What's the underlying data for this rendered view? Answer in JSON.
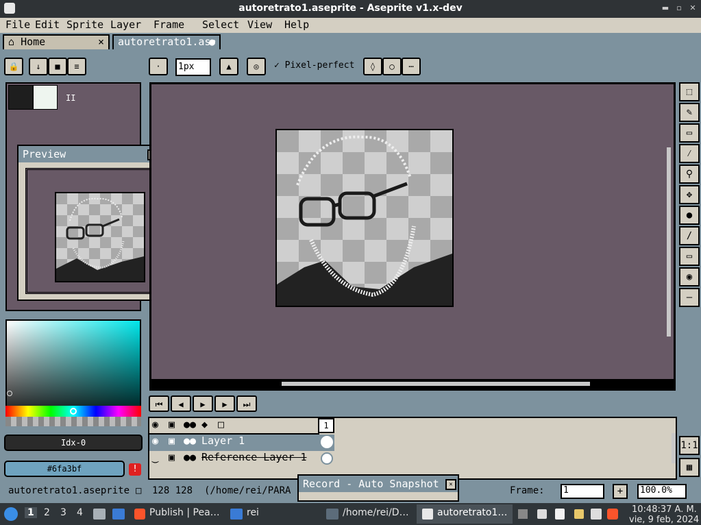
{
  "window": {
    "title": "autoretrato1.aseprite - Aseprite v1.x-dev"
  },
  "menu": [
    "File",
    "Edit",
    "Sprite",
    "Layer",
    "Frame",
    "Select",
    "View",
    "Help"
  ],
  "tabs": {
    "home": "Home",
    "doc": "autoretrato1.as•",
    "home_close": "×",
    "doc_dot": "●"
  },
  "context_bar": {
    "brush_size": "1px",
    "pixel_perfect": "Pixel-perfect",
    "more": "⋯"
  },
  "palette": {
    "count_label": "II"
  },
  "preview": {
    "title": "Preview"
  },
  "color": {
    "index": "Idx-0",
    "hex": "#6fa3bf",
    "warning": "!"
  },
  "timeline": {
    "frame_number": "1",
    "layers": [
      {
        "name": "Layer 1"
      },
      {
        "name": "Reference Layer 1"
      }
    ]
  },
  "status": {
    "filename": "autoretrato1.aseprite",
    "size": "128 128",
    "path": "(/home/rei/PARA",
    "frame_label": "Frame:",
    "frame_value": "1",
    "zoom": "100.0%",
    "plus": "+"
  },
  "snapshot": {
    "title": "Record - Auto Snapshot",
    "close": "✕"
  },
  "taskbar": {
    "workspaces": [
      "1",
      "2",
      "3",
      "4"
    ],
    "apps": [
      "Publish | Pea…",
      "rei",
      "/home/rei/D…",
      "autoretrato1…"
    ],
    "time": "10:48:37 A. M.",
    "date": "vie, 9 feb, 2024"
  },
  "colors": {
    "canvas_bg": "#685966",
    "ui_blue": "#7d929e",
    "ui_beige": "#d4cfc2",
    "accent_red": "#e02020"
  }
}
